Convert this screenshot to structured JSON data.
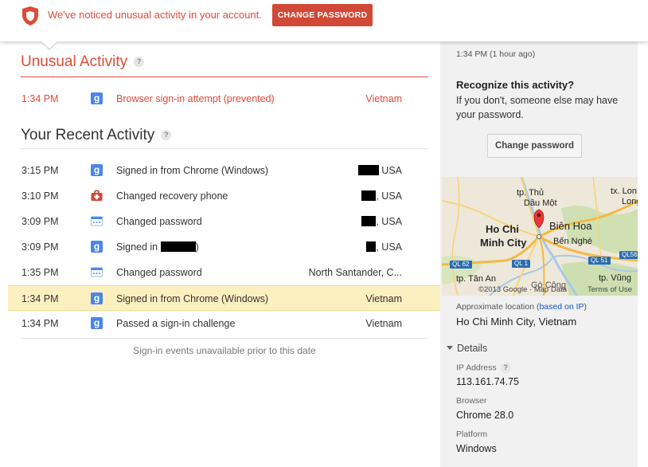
{
  "alert": {
    "message": "We've noticed unusual activity in your account.",
    "button_label": "CHANGE PASSWORD",
    "accent_color": "#dd4b39"
  },
  "unusual": {
    "title": "Unusual Activity",
    "help": "?",
    "rows": [
      {
        "time": "1:34 PM",
        "icon": "google-icon",
        "desc": "Browser sign-in attempt (prevented)",
        "loc": "Vietnam"
      }
    ]
  },
  "recent": {
    "title": "Your Recent Activity",
    "help": "?",
    "rows": [
      {
        "time": "3:15 PM",
        "icon": "google-icon",
        "desc": "Signed in from Chrome (Windows)",
        "loc": "USA"
      },
      {
        "time": "3:10 PM",
        "icon": "first-aid-kit-icon",
        "desc": "Changed recovery phone",
        "loc": "USA"
      },
      {
        "time": "3:09 PM",
        "icon": "password-card-icon",
        "desc": "Changed password",
        "loc": "USA"
      },
      {
        "time": "3:09 PM",
        "icon": "google-icon",
        "desc_prefix": "Signed in",
        "desc_suffix": ")",
        "loc": "USA"
      },
      {
        "time": "1:35 PM",
        "icon": "password-card-icon",
        "desc": "Changed password",
        "loc": "North Santander, C..."
      },
      {
        "time": "1:34 PM",
        "icon": "google-icon",
        "desc": "Signed in from Chrome (Windows)",
        "loc": "Vietnam",
        "highlighted": true
      },
      {
        "time": "1:34 PM",
        "icon": "google-icon",
        "desc": "Passed a sign-in challenge",
        "loc": "Vietnam"
      }
    ],
    "footer": "Sign-in events unavailable prior to this date"
  },
  "details_panel": {
    "time_ago": "1:34 PM (1 hour ago)",
    "question": "Recognize this activity?",
    "subtext": "If you don't, someone else may have your password.",
    "button_label": "Change password",
    "map": {
      "labels": {
        "tp_thu": "tp. Thủ",
        "dau_mot": "Dầu Một",
        "ho_chi": "Ho Chi",
        "minh_city": "Minh City",
        "bien_hoa": "Biên Hoa",
        "ben_nghe": "Bến Nghé",
        "tan_an": "tp. Tân An",
        "go_cong": "Gò Công",
        "vung": "tp. Vũng",
        "lon": "tx. Lon",
        "long": "Long",
        "ql62": "QL 62",
        "ql1": "QL 1",
        "ql51": "QL 51",
        "ql56": "QL56"
      },
      "copyright": "©2013 Google · Map Data",
      "terms": "Terms of Use"
    },
    "approx_label": "Approximate location (",
    "approx_link": "based on IP",
    "approx_close": ")",
    "city": "Ho Chi Minh City, Vietnam",
    "details_toggle": "Details",
    "ip_label": "IP Address",
    "ip_help": "?",
    "ip_value": "113.161.74.75",
    "browser_label": "Browser",
    "browser_value": "Chrome 28.0",
    "platform_label": "Platform",
    "platform_value": "Windows"
  }
}
